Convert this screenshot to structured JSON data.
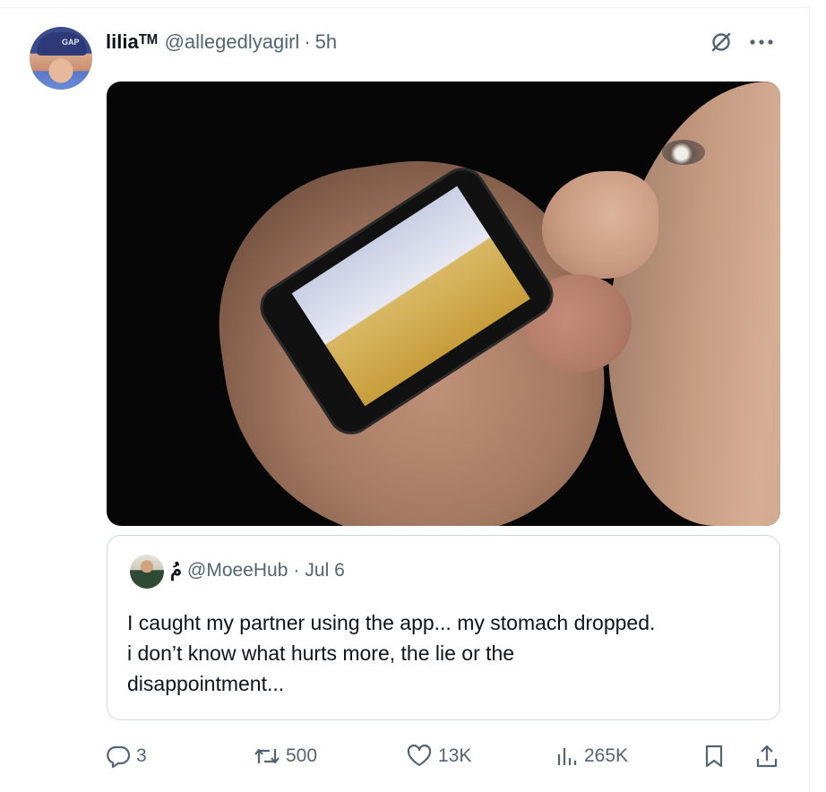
{
  "tweet": {
    "author_name": "liliaᵀᴹ",
    "handle": "@allegedlyagirl",
    "separator": "·",
    "time": "5h",
    "avatar_text": "GAP"
  },
  "quoted": {
    "author_name": "مُ",
    "handle": "@MoeeHub",
    "separator": "·",
    "time": "Jul 6",
    "text": "I caught my partner using the app... my stomach dropped.\ni don’t know what hurts more, the lie or the\ndisappointment..."
  },
  "actions": {
    "replies": "3",
    "reposts": "500",
    "likes": "13K",
    "views": "265K"
  },
  "icons": {
    "grok": "grok-icon",
    "more": "more-icon",
    "reply": "reply-icon",
    "repost": "repost-icon",
    "like": "heart-icon",
    "views": "analytics-icon",
    "bookmark": "bookmark-icon",
    "share": "share-icon"
  },
  "colors": {
    "text": "#0f1419",
    "secondary": "#536471",
    "border": "#cfd9de"
  }
}
